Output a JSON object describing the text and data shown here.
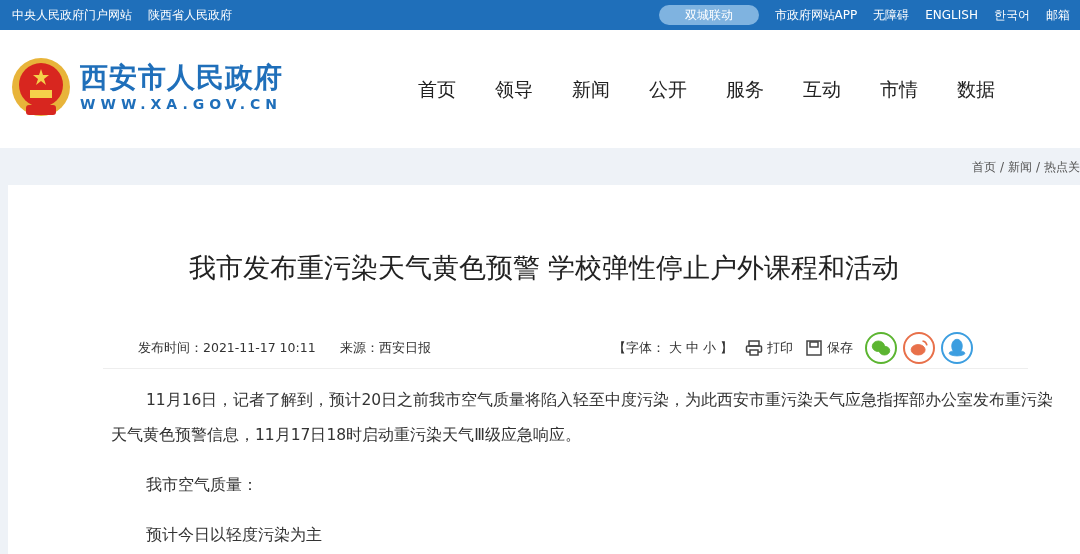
{
  "top_bar": {
    "left_links": [
      "中央人民政府门户网站",
      "陕西省人民政府"
    ],
    "highlight_button": "双城联动",
    "right_links": [
      "市政府网站APP",
      "无障碍",
      "ENGLISH",
      "한국어",
      "邮箱"
    ]
  },
  "header": {
    "site_name": "西安市人民政府",
    "site_url": "WWW.XA.GOV.CN",
    "nav": [
      {
        "label": "首页"
      },
      {
        "label": "领导"
      },
      {
        "label": "新闻"
      },
      {
        "label": "公开"
      },
      {
        "label": "服务"
      },
      {
        "label": "互动"
      },
      {
        "label": "市情"
      },
      {
        "label": "数据"
      }
    ]
  },
  "breadcrumb": {
    "items": [
      "首页",
      "新闻",
      "热点关"
    ],
    "separator": "/"
  },
  "article": {
    "title": "我市发布重污染天气黄色预警 学校弹性停止户外课程和活动",
    "publish_time": "发布时间：2021-11-17 10:11",
    "source": "来源：西安日报",
    "font_size": {
      "prefix": "【字体：",
      "options": [
        "大",
        "中",
        "小"
      ],
      "suffix": "】"
    },
    "actions": [
      {
        "kind": "print",
        "label": "打印"
      },
      {
        "kind": "save",
        "label": "保存"
      }
    ],
    "share": [
      {
        "kind": "wechat",
        "color": "#5cb531"
      },
      {
        "kind": "weibo",
        "color": "#e8704a"
      },
      {
        "kind": "qq",
        "color": "#3c9ee0"
      }
    ],
    "paragraphs": [
      "11月16日，记者了解到，预计20日之前我市空气质量将陷入轻至中度污染，为此西安市重污染天气应急指挥部办公室发布重污染天气黄色预警信息，11月17日18时启动重污染天气Ⅲ级应急响应。",
      "我市空气质量：",
      "预计今日以轻度污染为主"
    ]
  }
}
